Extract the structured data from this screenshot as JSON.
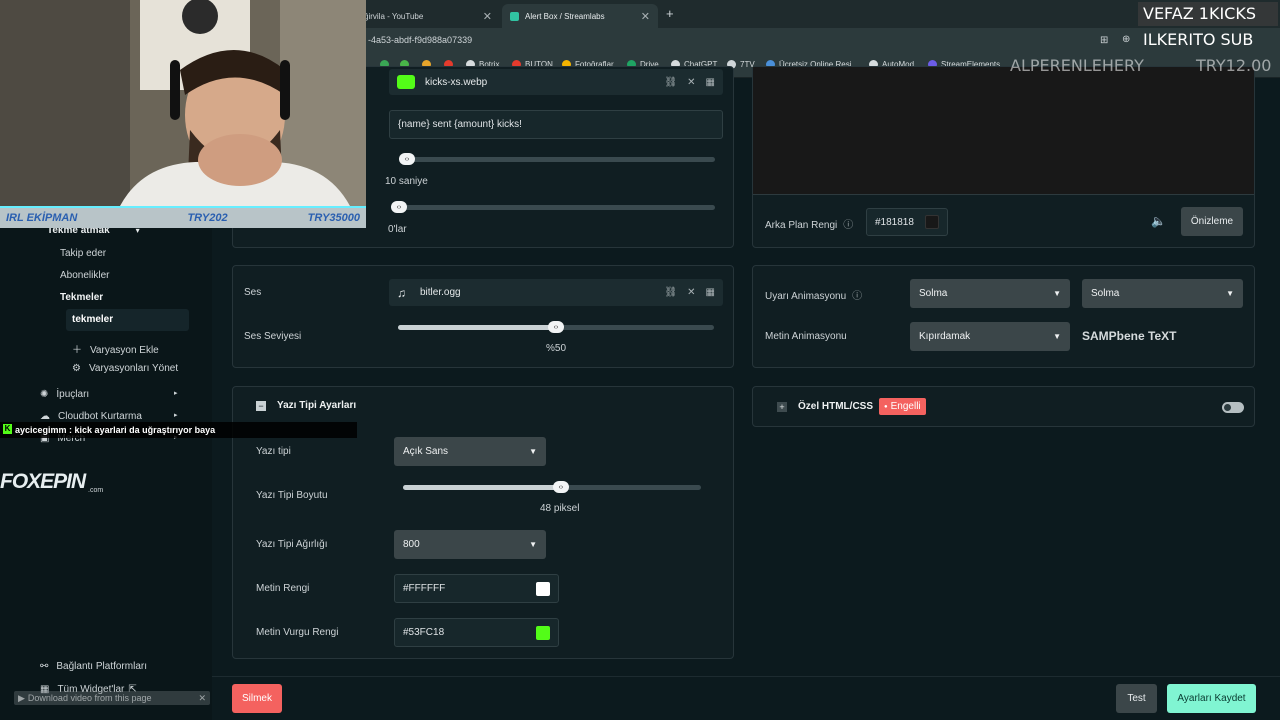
{
  "browser": {
    "tabs": [
      {
        "title": "ğirvila - YouTube",
        "active": false
      },
      {
        "title": "Alert Box / Streamlabs",
        "active": true
      }
    ],
    "new_tab": "+",
    "url": "-4a53-abdf-f9d988a07339",
    "bookmarks": [
      "Botrix",
      "BUTON",
      "Fotoğraflar",
      "Drive",
      "ChatGPT",
      "7TV",
      "Ücretsiz Online Resi...",
      "AutoMod",
      "StreamElements"
    ]
  },
  "overlay": {
    "top_right": "VEFAZ 1KICKS",
    "sub": "ILKERITO SUB",
    "ticker_left": "ALPERENLEHERY",
    "ticker_right": "TRY12.00",
    "cam_footer": {
      "label": "IRL EKİPMAN",
      "v1": "TRY202",
      "v2": "TRY35000"
    },
    "chat": {
      "user": "aycicegimm",
      "message": ": kick ayarlari da uğraştırıyor baya"
    },
    "sponsor": "FOXEPIN",
    "sponsor_sub": ".com",
    "download": "Download video from this page"
  },
  "sidebar": {
    "group": "Tekme atmak",
    "items": [
      "Takip eder",
      "Abonelikler",
      "Tekmeler"
    ],
    "active_sub": "tekmeler",
    "add_variation": "Varyasyon Ekle",
    "manage_variations": "Varyasyonları Yönet",
    "tips": "İpuçları",
    "cloudbot": "Cloudbot Kurtarma",
    "merch": "Merch",
    "connected": "Bağlantı Platformları",
    "all_widgets": "Tüm Widget'lar"
  },
  "top_panel": {
    "image_file": "kicks-xs.webp",
    "message_template": "{name} sent {amount} kicks!",
    "duration_label": "10 saniye",
    "delay_label": "0'lar"
  },
  "preview": {
    "bg_label": "Arka Plan Rengi",
    "bg_value": "#181818",
    "bg_color": "#181818",
    "preview_button": "Önizleme"
  },
  "sound": {
    "label": "Ses",
    "file": "bitler.ogg",
    "volume_label": "Ses Seviyesi",
    "volume_value": "%50",
    "volume_fraction": 0.5
  },
  "animation": {
    "alert_label": "Uyarı Animasyonu",
    "alert_in": "Solma",
    "alert_out": "Solma",
    "text_label": "Metin Animasyonu",
    "text_value": "Kıpırdamak",
    "sample": "SAMPbene TeXT"
  },
  "font": {
    "section_title": "Yazı Tipi Ayarları",
    "type_label": "Yazı tipi",
    "type_value": "Açık Sans",
    "size_label": "Yazı Tipi Boyutu",
    "size_value": "48 piksel",
    "size_fraction": 0.53,
    "weight_label": "Yazı Tipi Ağırlığı",
    "weight_value": "800",
    "color_label": "Metin Rengi",
    "color_value": "#FFFFFF",
    "color_swatch": "#FFFFFF",
    "highlight_label": "Metin Vurgu Rengi",
    "highlight_value": "#53FC18",
    "highlight_swatch": "#53FC18"
  },
  "custom": {
    "title": "Özel HTML/CSS",
    "badge": "Engelli",
    "enabled": false
  },
  "footer": {
    "delete": "Silmek",
    "test": "Test",
    "save": "Ayarları Kaydet"
  }
}
